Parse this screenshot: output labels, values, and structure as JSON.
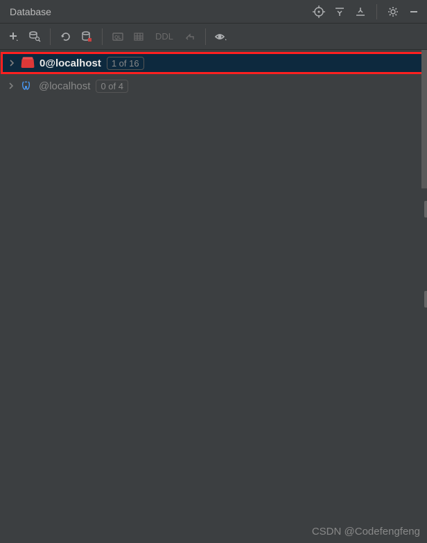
{
  "header": {
    "title": "Database"
  },
  "toolbar": {
    "ddl_label": "DDL"
  },
  "tree": {
    "items": [
      {
        "label": "0@localhost",
        "badge": "1 of 16",
        "selected": true,
        "highlighted": true,
        "icon": "redis"
      },
      {
        "label": "@localhost",
        "badge": "0 of 4",
        "selected": false,
        "highlighted": false,
        "icon": "postgres"
      }
    ]
  },
  "watermark": "CSDN @Codefengfeng"
}
